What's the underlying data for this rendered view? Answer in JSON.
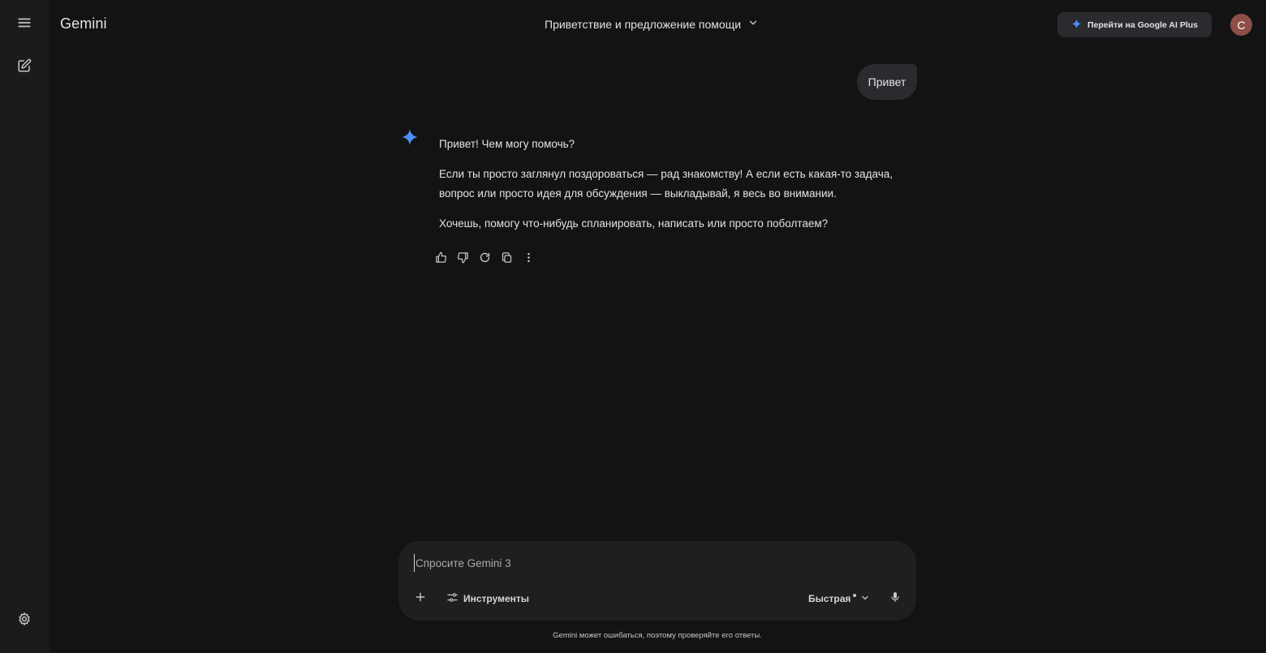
{
  "app": {
    "brand": "Gemini",
    "chat_title": "Приветствие и предложение помощи",
    "upgrade_label": "Перейти на Google AI Plus",
    "avatar_letter": "C",
    "accent": "#4d8ef7"
  },
  "sidebar": {
    "icons": [
      "menu-icon",
      "new-chat-icon",
      "settings-icon"
    ]
  },
  "conversation": {
    "user_message": "Привет",
    "response": {
      "p1": "Привет! Чем могу помочь?",
      "p2": "Если ты просто заглянул поздороваться — рад знакомству! А если есть какая-то задача, вопрос или просто идея для обсуждения — выкладывай, я весь во внимании.",
      "p3": "Хочешь, помогу что-нибудь спланировать, написать или просто поболтаем?"
    },
    "actions": [
      "thumbs-up-icon",
      "thumbs-down-icon",
      "regenerate-icon",
      "copy-icon",
      "more-vert-icon"
    ]
  },
  "composer": {
    "placeholder": "Спросите Gemini 3",
    "tools_label": "Инструменты",
    "mode_label": "Быстрая"
  },
  "footer": {
    "disclaimer": "Gemini может ошибаться, поэтому проверяйте его ответы."
  }
}
